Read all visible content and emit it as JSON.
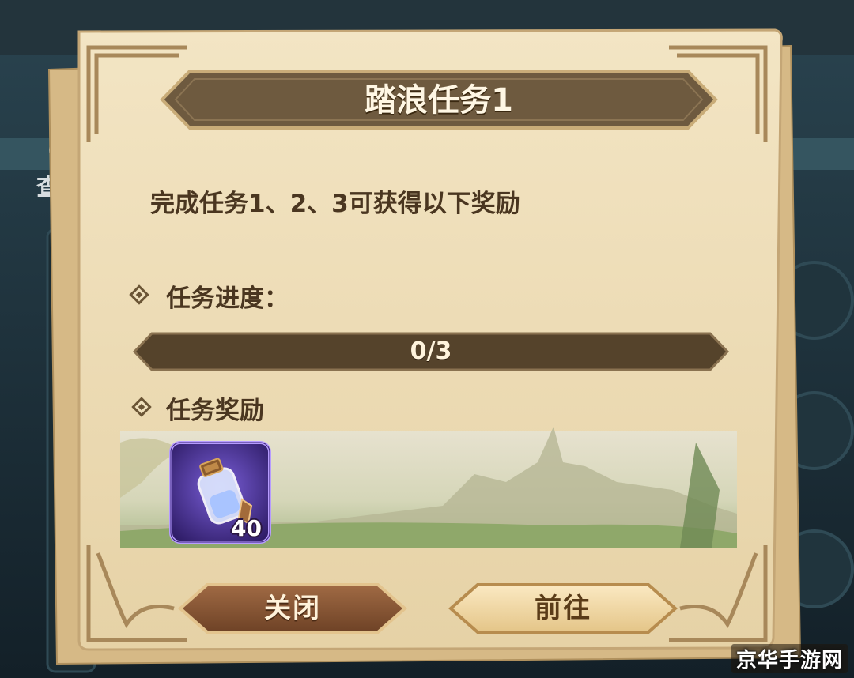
{
  "background": {
    "partial_label": "查看"
  },
  "dialog": {
    "title": "踏浪任务1",
    "description": "完成任务1、2、3可获得以下奖励",
    "progress_section_label": "任务进度：",
    "progress": {
      "text": "0/3",
      "current": 0,
      "total": 3
    },
    "reward_section_label": "任务奖励",
    "rewards": [
      {
        "icon": "potion-bottle-icon",
        "quantity": "40"
      }
    ],
    "buttons": {
      "close_label": "关闭",
      "go_label": "前往"
    }
  },
  "watermark": "京华手游网",
  "colors": {
    "parchment": "#efdfbb",
    "banner": "#6e5a3f",
    "progress_track": "#55432b",
    "button_close": "#8a5a38",
    "button_go": "#f1d7a3",
    "item_frame": "#6a44b8"
  }
}
